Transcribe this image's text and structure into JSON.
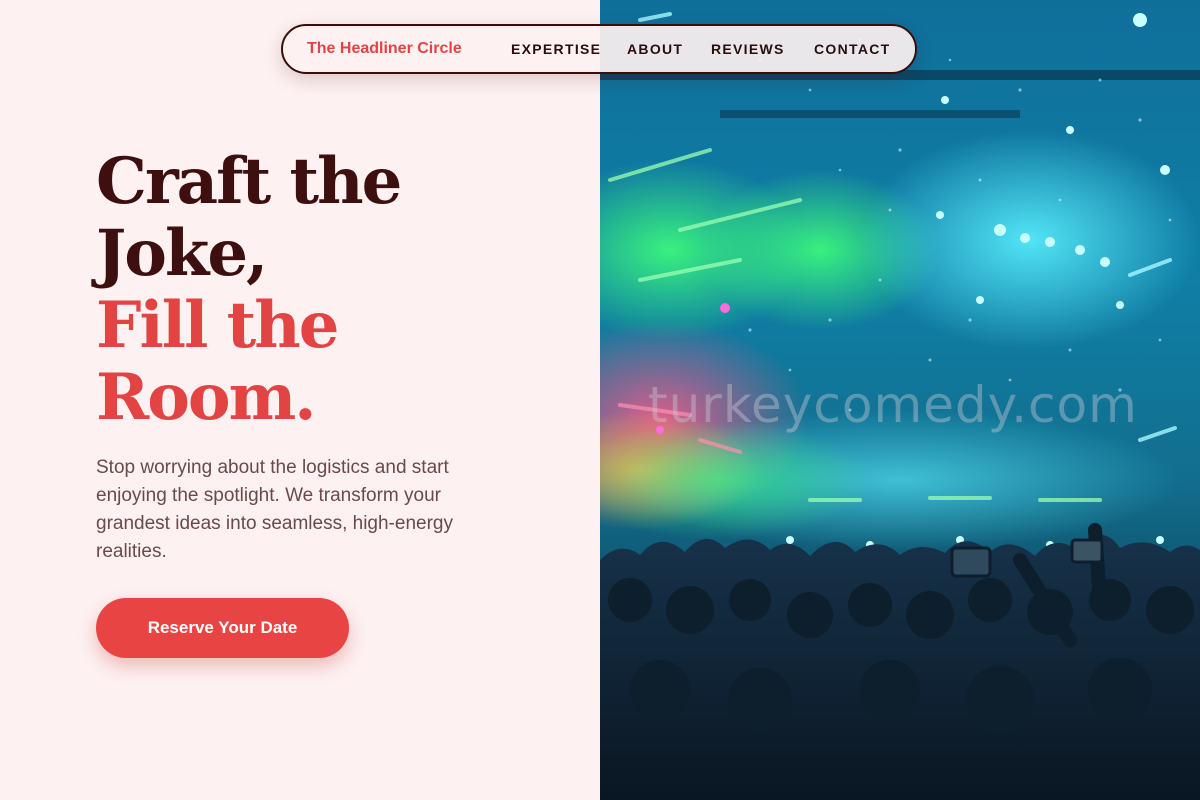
{
  "nav": {
    "brand": "The Headliner Circle",
    "links": [
      {
        "label": "EXPERTISE"
      },
      {
        "label": "ABOUT"
      },
      {
        "label": "REVIEWS"
      },
      {
        "label": "CONTACT"
      }
    ]
  },
  "hero": {
    "headline_line1": "Craft the",
    "headline_line2": "Joke,",
    "headline_line3": "Fill the",
    "headline_line4": "Room.",
    "subtitle": "Stop worrying about the logistics and start enjoying the spotlight. We transform your grandest ideas into seamless, high-energy realities.",
    "cta_label": "Reserve Your Date"
  },
  "image": {
    "watermark": "turkeycomedy.com",
    "subject": "concert-crowd-photo"
  },
  "colors": {
    "background": "#fdf1f1",
    "accent": "#e24444",
    "heading_dark": "#3d0f0f",
    "body_text": "#6a4a4a"
  }
}
